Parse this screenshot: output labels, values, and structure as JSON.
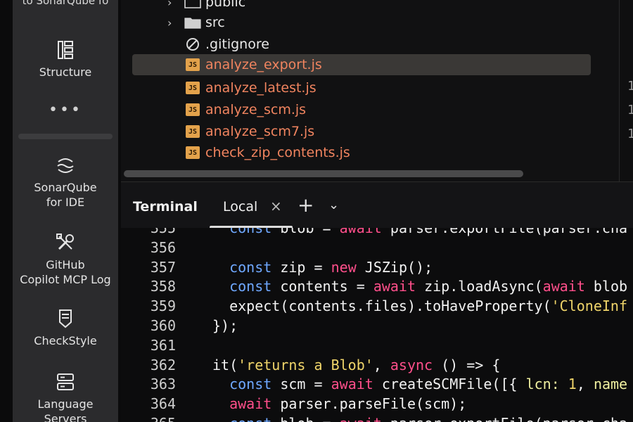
{
  "sidebar": {
    "top_label": "to SonarQube fo",
    "more": "•••",
    "items": [
      {
        "label_lines": [
          "Structure"
        ],
        "icon": "structure-icon"
      },
      {
        "label_lines": [
          "SonarQube",
          "for IDE"
        ],
        "icon": "sonarqube-icon"
      },
      {
        "label_lines": [
          "GitHub",
          "Copilot MCP Log"
        ],
        "icon": "tools-icon"
      },
      {
        "label_lines": [
          "CheckStyle"
        ],
        "icon": "checkstyle-icon"
      },
      {
        "label_lines": [
          "Language",
          "Servers"
        ],
        "icon": "servers-icon"
      }
    ]
  },
  "tree": {
    "rows": [
      {
        "name": "public",
        "kind": "folder"
      },
      {
        "name": "src",
        "kind": "folder"
      },
      {
        "name": ".gitignore",
        "kind": "ignore"
      },
      {
        "name": "analyze_export.js",
        "kind": "js",
        "selected": true
      },
      {
        "name": "analyze_latest.js",
        "kind": "js"
      },
      {
        "name": "analyze_scm.js",
        "kind": "js"
      },
      {
        "name": "analyze_scm7.js",
        "kind": "js"
      },
      {
        "name": "check_zip_contents.js",
        "kind": "js"
      }
    ],
    "js_badge": "JS",
    "right_gutter_numbers": [
      "1",
      "1",
      "1"
    ]
  },
  "terminal": {
    "title": "Terminal",
    "tab": "Local",
    "close": "×",
    "add": "+",
    "more": "⌄"
  },
  "code": {
    "lines": [
      {
        "n": "355",
        "tokens": [
          [
            "  ",
            ""
          ],
          [
            "const",
            "kw"
          ],
          [
            " blob = ",
            ""
          ],
          [
            "await",
            "kw2"
          ],
          [
            " parser.exportFile(parser.cha",
            ""
          ]
        ]
      },
      {
        "n": "356",
        "tokens": []
      },
      {
        "n": "357",
        "tokens": [
          [
            "  ",
            ""
          ],
          [
            "const",
            "kw"
          ],
          [
            " zip = ",
            ""
          ],
          [
            "new",
            "kw2"
          ],
          [
            " JSZip();",
            ""
          ]
        ]
      },
      {
        "n": "358",
        "tokens": [
          [
            "  ",
            ""
          ],
          [
            "const",
            "kw"
          ],
          [
            " contents = ",
            ""
          ],
          [
            "await",
            "kw2"
          ],
          [
            " zip.loadAsync(",
            ""
          ],
          [
            "await",
            "kw2"
          ],
          [
            " blob",
            ""
          ]
        ]
      },
      {
        "n": "359",
        "tokens": [
          [
            "  expect(contents.files).toHaveProperty(",
            ""
          ],
          [
            "'CloneInf",
            "str"
          ]
        ]
      },
      {
        "n": "360",
        "tokens": [
          [
            "});",
            ""
          ]
        ]
      },
      {
        "n": "361",
        "tokens": []
      },
      {
        "n": "362",
        "tokens": [
          [
            "it(",
            ""
          ],
          [
            "'returns a Blob'",
            "str"
          ],
          [
            ", ",
            ""
          ],
          [
            "async",
            "kw2"
          ],
          [
            " () => {",
            ""
          ]
        ]
      },
      {
        "n": "363",
        "tokens": [
          [
            "  ",
            ""
          ],
          [
            "const",
            "kw"
          ],
          [
            " scm = ",
            ""
          ],
          [
            "await",
            "kw2"
          ],
          [
            " createSCMFile([{ ",
            ""
          ],
          [
            "lcn:",
            "prop"
          ],
          [
            " ",
            ""
          ],
          [
            "1",
            "num"
          ],
          [
            ", ",
            ""
          ],
          [
            "name",
            "prop"
          ]
        ]
      },
      {
        "n": "364",
        "tokens": [
          [
            "  ",
            ""
          ],
          [
            "await",
            "kw2"
          ],
          [
            " parser.parseFile(scm);",
            ""
          ]
        ]
      },
      {
        "n": "365",
        "tokens": [
          [
            "  ",
            ""
          ],
          [
            "const",
            "kw"
          ],
          [
            " blob = ",
            ""
          ],
          [
            "await",
            "kw2"
          ],
          [
            " parser.exportFile(parser.cha",
            ""
          ]
        ]
      }
    ]
  }
}
